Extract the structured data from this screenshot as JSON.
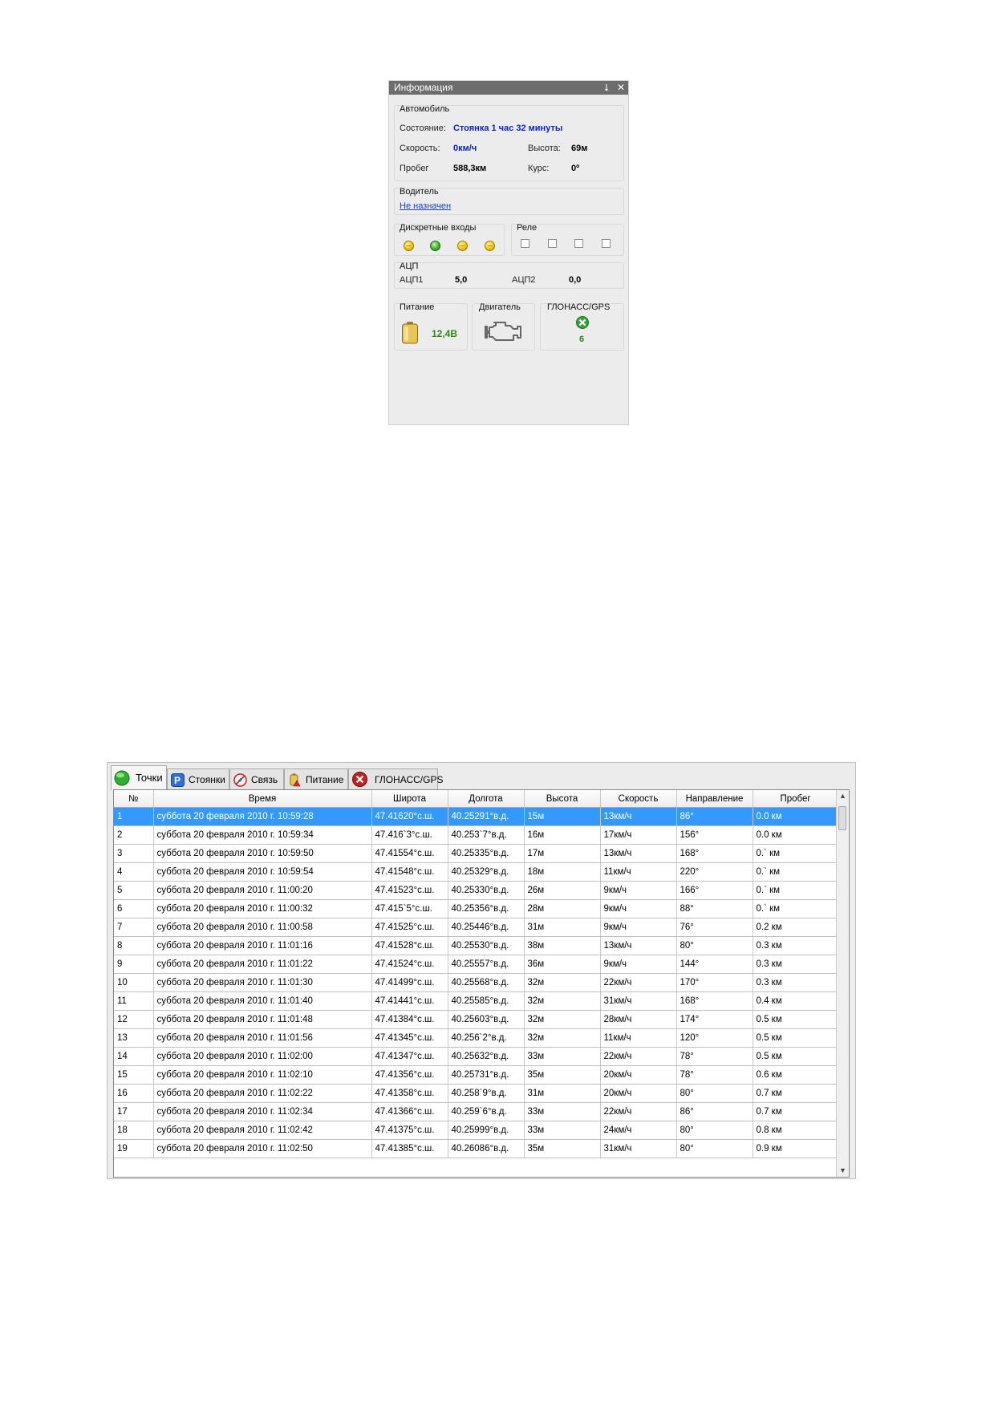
{
  "info_panel": {
    "title": "Информация",
    "pin_icon": "pin-icon",
    "close_icon": "close-icon",
    "car": {
      "legend": "Автомобиль",
      "state_label": "Состояние:",
      "state_value": "Стоянка 1 час 32 минуты",
      "speed_label": "Скорость:",
      "speed_value": "0км/ч",
      "altitude_label": "Высота:",
      "altitude_value": "69м",
      "mileage_label": "Пробег",
      "mileage_value": "588,3км",
      "course_label": "Курс:",
      "course_value": "0º"
    },
    "driver": {
      "legend": "Водитель",
      "value": "Не назначен"
    },
    "discrete_inputs": {
      "legend": "Дискретные входы",
      "states": [
        "off",
        "on",
        "off",
        "off"
      ]
    },
    "relay": {
      "legend": "Реле",
      "checked": [
        false,
        false,
        false,
        false
      ]
    },
    "adc": {
      "legend": "АЦП",
      "adc1_label": "АЦП1",
      "adc1_value": "5,0",
      "adc2_label": "АЦП2",
      "adc2_value": "0,0"
    },
    "power": {
      "legend": "Питание",
      "value": "12,4В"
    },
    "engine": {
      "legend": "Двигатель"
    },
    "gnss": {
      "legend": "ГЛОНАСС/GPS",
      "satellites": "6"
    }
  },
  "grid_window": {
    "tabs": [
      {
        "label": "Точки",
        "icon": "green-dot-icon",
        "active": true
      },
      {
        "label": "Стоянки",
        "icon": "parking-icon",
        "active": false
      },
      {
        "label": "Связь",
        "icon": "connection-icon",
        "active": false
      },
      {
        "label": "Питание",
        "icon": "battery-warning-icon",
        "active": false
      },
      {
        "label": "ГЛОНАСС/GPS",
        "icon": "satellite-error-icon",
        "active": false
      }
    ],
    "columns": [
      "№",
      "Время",
      "Широта",
      "Долгота",
      "Высота",
      "Скорость",
      "Направление",
      "Пробег"
    ],
    "selected_row": 0,
    "rows": [
      [
        "1",
        "суббота 20 февраля 2010 г. 10:59:28",
        "47.41620°с.ш.",
        "40.25291°в.д.",
        "15м",
        "13км/ч",
        "86°",
        "0.0 км"
      ],
      [
        "2",
        "суббота 20 февраля 2010 г. 10:59:34",
        "47.416`3°с.ш.",
        "40.253`7°в.д.",
        "16м",
        "17км/ч",
        "156°",
        "0.0 км"
      ],
      [
        "3",
        "суббота 20 февраля 2010 г. 10:59:50",
        "47.41554°с.ш.",
        "40.25335°в.д.",
        "17м",
        "13км/ч",
        "168°",
        "0.` км"
      ],
      [
        "4",
        "суббота 20 февраля 2010 г. 10:59:54",
        "47.41548°с.ш.",
        "40.25329°в.д.",
        "18м",
        "11км/ч",
        "220°",
        "0.` км"
      ],
      [
        "5",
        "суббота 20 февраля 2010 г. 11:00:20",
        "47.41523°с.ш.",
        "40.25330°в.д.",
        "26м",
        "9км/ч",
        "166°",
        "0.` км"
      ],
      [
        "6",
        "суббота 20 февраля 2010 г. 11:00:32",
        "47.415`5°с.ш.",
        "40.25356°в.д.",
        "28м",
        "9км/ч",
        "88°",
        "0.` км"
      ],
      [
        "7",
        "суббота 20 февраля 2010 г. 11:00:58",
        "47.41525°с.ш.",
        "40.25446°в.д.",
        "31м",
        "9км/ч",
        "76°",
        "0.2 км"
      ],
      [
        "8",
        "суббота 20 февраля 2010 г. 11:01:16",
        "47.41528°с.ш.",
        "40.25530°в.д.",
        "38м",
        "13км/ч",
        "80°",
        "0.3 км"
      ],
      [
        "9",
        "суббота 20 февраля 2010 г. 11:01:22",
        "47.41524°с.ш.",
        "40.25557°в.д.",
        "36м",
        "9км/ч",
        "144°",
        "0.3 км"
      ],
      [
        "10",
        "суббота 20 февраля 2010 г. 11:01:30",
        "47.41499°с.ш.",
        "40.25568°в.д.",
        "32м",
        "22км/ч",
        "170°",
        "0.3 км"
      ],
      [
        "11",
        "суббота 20 февраля 2010 г. 11:01:40",
        "47.41441°с.ш.",
        "40.25585°в.д.",
        "32м",
        "31км/ч",
        "168°",
        "0.4 км"
      ],
      [
        "12",
        "суббота 20 февраля 2010 г. 11:01:48",
        "47.41384°с.ш.",
        "40.25603°в.д.",
        "32м",
        "28км/ч",
        "174°",
        "0.5 км"
      ],
      [
        "13",
        "суббота 20 февраля 2010 г. 11:01:56",
        "47.41345°с.ш.",
        "40.256`2°в.д.",
        "32м",
        "11км/ч",
        "120°",
        "0.5 км"
      ],
      [
        "14",
        "суббота 20 февраля 2010 г. 11:02:00",
        "47.41347°с.ш.",
        "40.25632°в.д.",
        "33м",
        "22км/ч",
        "78°",
        "0.5 км"
      ],
      [
        "15",
        "суббота 20 февраля 2010 г. 11:02:10",
        "47.41356°с.ш.",
        "40.25731°в.д.",
        "35м",
        "20км/ч",
        "78°",
        "0.6 км"
      ],
      [
        "16",
        "суббота 20 февраля 2010 г. 11:02:22",
        "47.41358°с.ш.",
        "40.258`9°в.д.",
        "31м",
        "20км/ч",
        "80°",
        "0.7 км"
      ],
      [
        "17",
        "суббота 20 февраля 2010 г. 11:02:34",
        "47.41366°с.ш.",
        "40.259`6°в.д.",
        "33м",
        "22км/ч",
        "86°",
        "0.7 км"
      ],
      [
        "18",
        "суббота 20 февраля 2010 г. 11:02:42",
        "47.41375°с.ш.",
        "40.25999°в.д.",
        "33м",
        "24км/ч",
        "80°",
        "0.8 км"
      ],
      [
        "19",
        "суббота 20 февраля 2010 г. 11:02:50",
        "47.41385°с.ш.",
        "40.26086°в.д.",
        "35м",
        "31км/ч",
        "80°",
        "0.9 км"
      ]
    ],
    "colors": {
      "selection": "#3399ff",
      "state_text": "#0b22c9",
      "power_text": "#2a8a14"
    }
  }
}
